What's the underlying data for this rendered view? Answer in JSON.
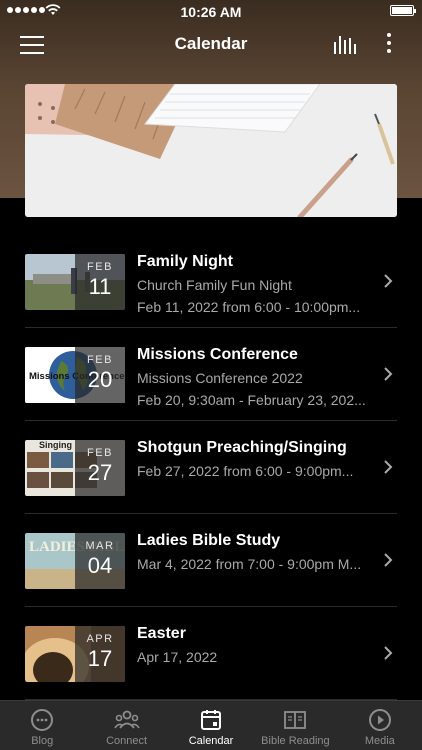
{
  "status_bar": {
    "time": "10:26 AM"
  },
  "header": {
    "title": "Calendar"
  },
  "events": [
    {
      "title": "Family Night",
      "lines": [
        "Church Family Fun Night",
        "Feb 11, 2022 from 6:00 - 10:00pm..."
      ],
      "month": "FEB",
      "day": "11"
    },
    {
      "title": "Missions Conference",
      "lines": [
        "Missions Conference 2022",
        "Feb 20, 9:30am - February 23, 202..."
      ],
      "month": "FEB",
      "day": "20",
      "thumb_text": "Missions Conference"
    },
    {
      "title": "Shotgun Preaching/Singing",
      "lines": [
        "Feb 27, 2022 from 6:00 - 9:00pm..."
      ],
      "month": "FEB",
      "day": "27",
      "thumb_text": "Singing"
    },
    {
      "title": "Ladies Bible Study",
      "lines": [
        "Mar 4, 2022 from 7:00 - 9:00pm M..."
      ],
      "month": "MAR",
      "day": "04",
      "thumb_text": "LADIES BIBLE"
    },
    {
      "title": "Easter",
      "lines": [
        "Apr 17, 2022"
      ],
      "month": "APR",
      "day": "17"
    }
  ],
  "tabs": [
    {
      "label": "Blog",
      "icon": "chat-bubble-icon",
      "active": false
    },
    {
      "label": "Connect",
      "icon": "people-icon",
      "active": false
    },
    {
      "label": "Calendar",
      "icon": "calendar-icon",
      "active": true
    },
    {
      "label": "Bible Reading",
      "icon": "book-icon",
      "active": false
    },
    {
      "label": "Media",
      "icon": "play-circle-icon",
      "active": false
    }
  ]
}
